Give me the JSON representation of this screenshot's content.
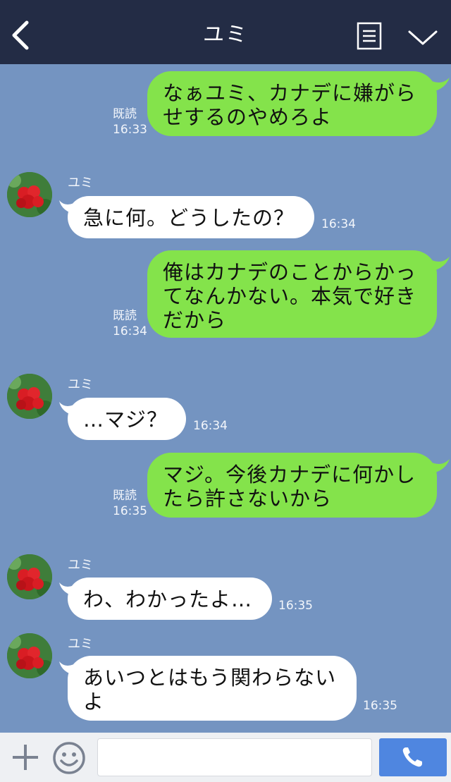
{
  "header": {
    "title": "ユミ"
  },
  "messages": [
    {
      "side": "right",
      "text_lines": [
        "なぁユミ、カナデに嫌がら",
        "せするのやめろよ"
      ],
      "read": "既読",
      "time": "16:33"
    },
    {
      "side": "left",
      "sender": "ユミ",
      "text_lines": [
        "急に何。どうしたの？"
      ],
      "time": "16:34"
    },
    {
      "side": "right",
      "text_lines": [
        "俺はカナデのことからかっ",
        "てなんかない。本気で好き",
        "だから"
      ],
      "read": "既読",
      "time": "16:34"
    },
    {
      "side": "left",
      "sender": "ユミ",
      "text_lines": [
        "…マジ？"
      ],
      "time": "16:34"
    },
    {
      "side": "right",
      "text_lines": [
        "マジ。今後カナデに何かし",
        "たら許さないから"
      ],
      "read": "既読",
      "time": "16:35"
    },
    {
      "side": "left",
      "sender": "ユミ",
      "text_lines": [
        "わ、わかったよ…"
      ],
      "time": "16:35"
    },
    {
      "side": "left",
      "sender": "ユミ",
      "text_lines": [
        "あいつとはもう関わらない",
        "よ"
      ],
      "time": "16:35"
    }
  ],
  "colors": {
    "background": "#7494c1",
    "header": "#232c45",
    "bubble_self": "#84e34b",
    "bubble_other": "#ffffff",
    "call_button": "#4f86e0"
  },
  "icons": {
    "back": "back-arrow-icon",
    "menu": "menu-list-icon",
    "collapse": "chevron-down-icon",
    "plus": "plus-icon",
    "emoji": "smiley-icon",
    "call": "phone-icon"
  }
}
